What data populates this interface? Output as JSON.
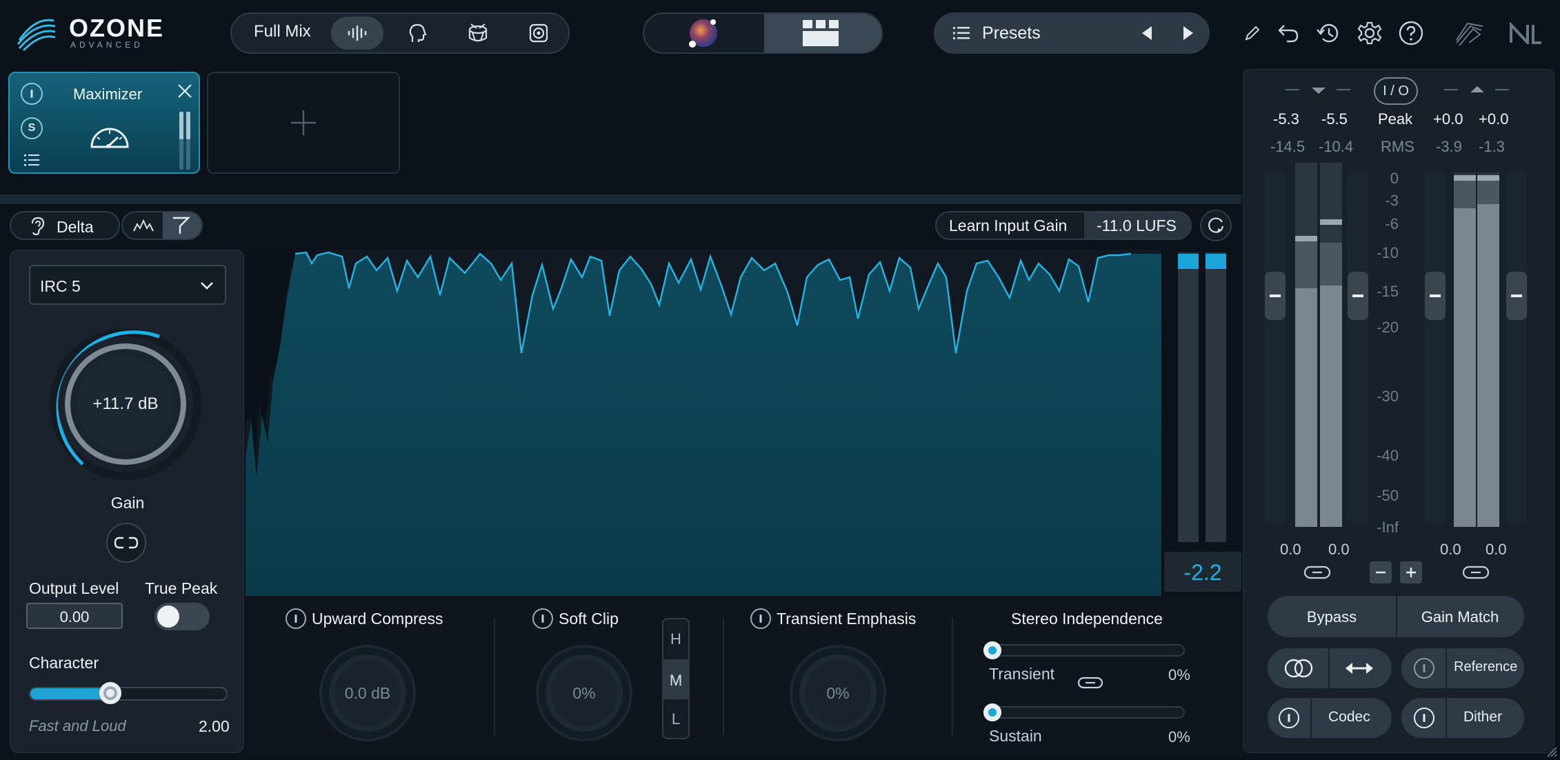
{
  "header": {
    "logo_text": "OZONE",
    "logo_sub": "ADVANCED",
    "mix_label": "Full Mix",
    "presets_label": "Presets"
  },
  "module": {
    "name": "Maximizer",
    "solo_label": "S",
    "add_label": "+"
  },
  "toolbar": {
    "delta_label": "Delta",
    "learn_label": "Learn Input Gain",
    "lufs_value": "-11.0 LUFS"
  },
  "left_panel": {
    "irc_value": "IRC 5",
    "gain_value": "+11.7 dB",
    "gain_label": "Gain",
    "output_level_label": "Output Level",
    "output_level_value": "0.00",
    "true_peak_label": "True Peak",
    "character_label": "Character",
    "character_mode": "Fast and Loud",
    "character_value": "2.00",
    "character_fraction": 0.41
  },
  "gr_meter": {
    "value": "-2.2"
  },
  "bottom": {
    "upward_label": "Upward Compress",
    "upward_value": "0.0 dB",
    "softclip_label": "Soft Clip",
    "softclip_value": "0%",
    "hml": [
      "H",
      "M",
      "L"
    ],
    "transient_label": "Transient Emphasis",
    "transient_value": "0%",
    "stereo_label": "Stereo Independence",
    "stereo_transient_label": "Transient",
    "stereo_transient_value": "0%",
    "stereo_sustain_label": "Sustain",
    "stereo_sustain_value": "0%"
  },
  "io": {
    "io_label": "I / O",
    "peak_label": "Peak",
    "rms_label": "RMS",
    "in_peak": [
      "-5.3",
      "-5.5"
    ],
    "in_rms": [
      "-14.5",
      "-10.4"
    ],
    "out_peak": [
      "+0.0",
      "+0.0"
    ],
    "out_rms": [
      "-3.9",
      "-1.3"
    ],
    "scale": [
      "0",
      "-3",
      "-6",
      "-10",
      "-15",
      "-20",
      "-30",
      "-40",
      "-50",
      "-Inf"
    ],
    "in_gain": [
      "0.0",
      "0.0"
    ],
    "out_gain": [
      "0.0",
      "0.0"
    ],
    "bypass_label": "Bypass",
    "gain_match_label": "Gain Match",
    "reference_label": "Reference",
    "codec_label": "Codec",
    "dither_label": "Dither"
  },
  "colors": {
    "accent": "#1aa6d6",
    "panel": "#18222c",
    "module_bg": "#0f4f63"
  }
}
